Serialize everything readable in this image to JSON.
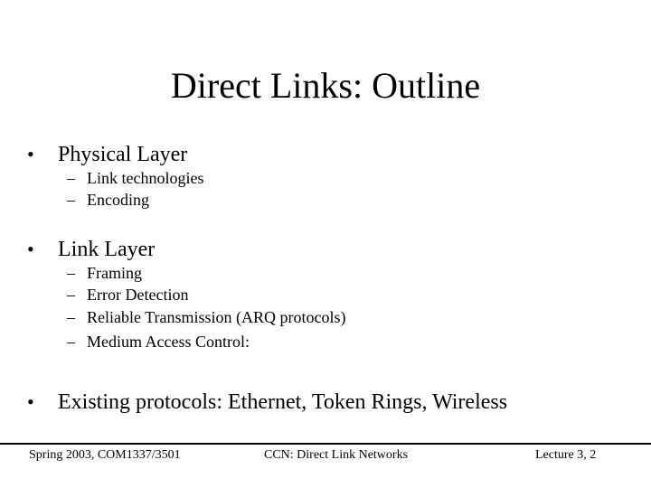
{
  "slide": {
    "title": "Direct Links: Outline",
    "sections": [
      {
        "bullet_icon": "•",
        "label": "Physical Layer",
        "items": [
          {
            "dash": "–",
            "label": "Link technologies"
          },
          {
            "dash": "–",
            "label": "Encoding"
          }
        ]
      },
      {
        "bullet_icon": "•",
        "label": "Link Layer",
        "items": [
          {
            "dash": "–",
            "label": "Framing"
          },
          {
            "dash": "–",
            "label": "Error Detection"
          },
          {
            "dash": "–",
            "label": "Reliable Transmission (ARQ protocols)"
          },
          {
            "dash": "–",
            "label": "Medium Access Control:"
          }
        ]
      },
      {
        "bullet_icon": "•",
        "label": "Existing protocols: Ethernet, Token Rings, Wireless",
        "items": []
      }
    ]
  },
  "footer": {
    "left": "Spring 2003, COM1337/3501",
    "center": "CCN: Direct Link Networks",
    "right": "Lecture 3, 2"
  },
  "colors": {
    "background": "#ffffff",
    "text": "#000000",
    "rule": "#000000"
  }
}
